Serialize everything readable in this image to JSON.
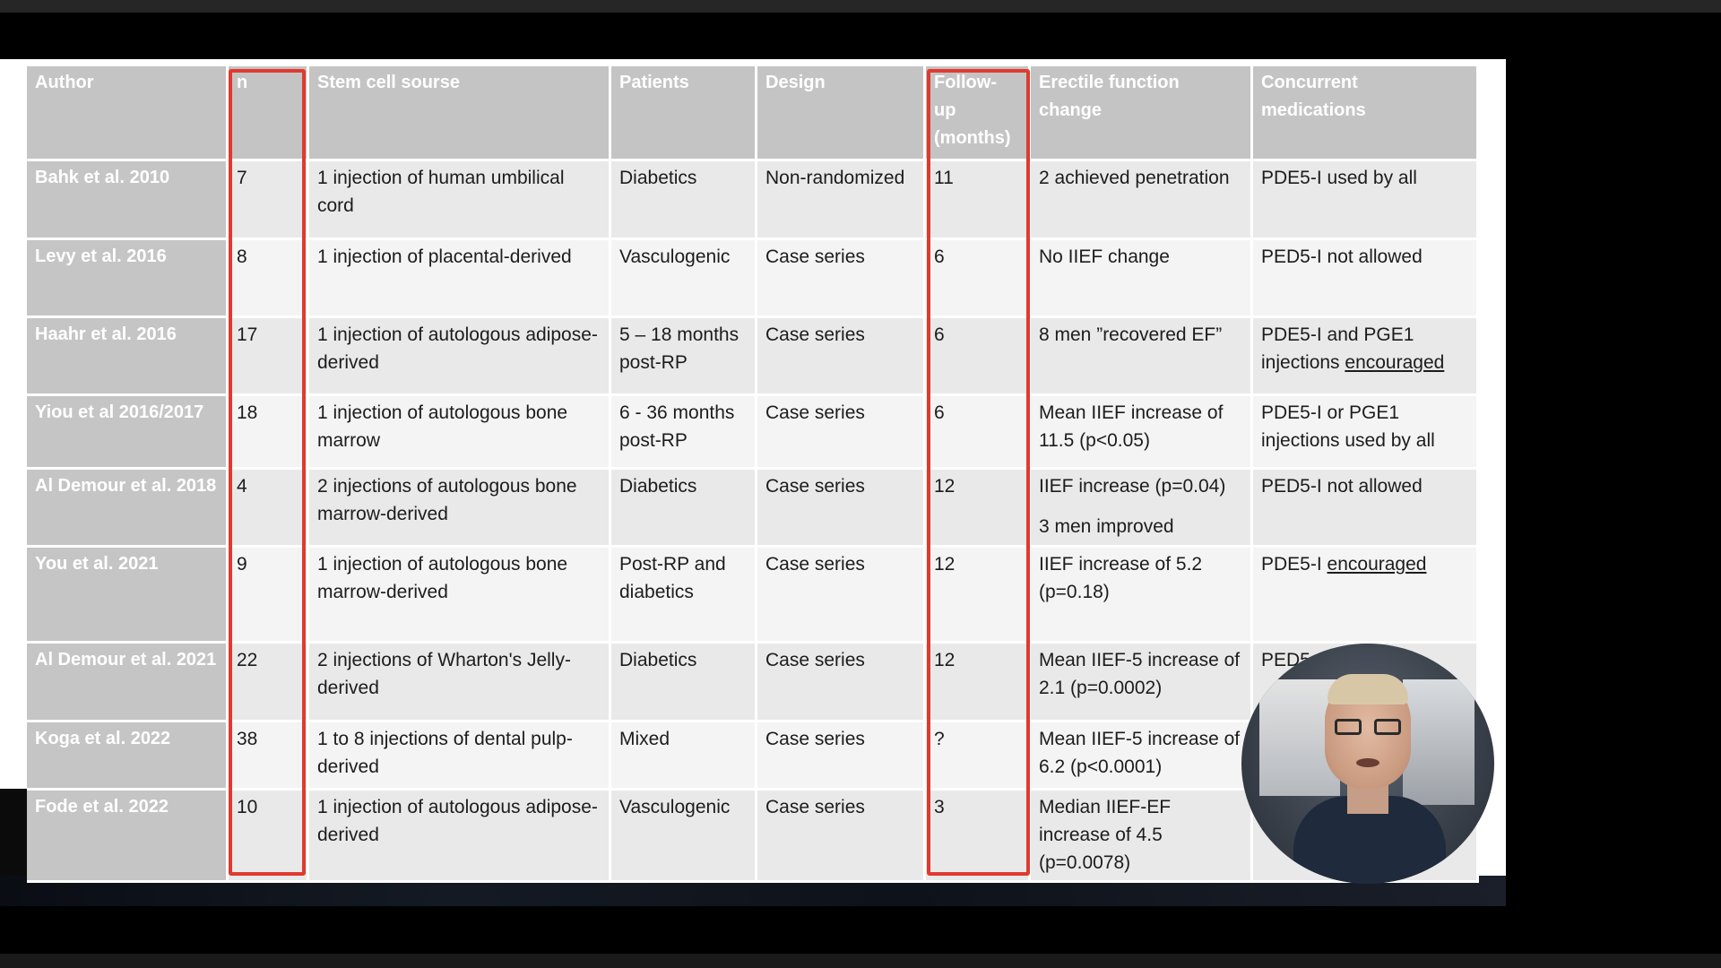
{
  "table": {
    "headers": [
      "Author",
      "n",
      "Stem cell sourse",
      "Patients",
      "Design",
      "Follow-up (months)",
      "Erectile function change",
      "Concurrent medications"
    ],
    "header_follow_up_lines": [
      "Follow-",
      "up",
      "(months)"
    ],
    "header_erectile_lines": [
      "Erectile function",
      "change"
    ],
    "header_concurrent_lines": [
      "Concurrent",
      "medications"
    ],
    "rows": [
      {
        "author": "Bahk et al.  2010",
        "n": "7",
        "source": "1 injection of human umbilical cord",
        "patients": "Diabetics",
        "design": "Non-randomized",
        "followup": "11",
        "ef_change": "2 achieved penetration",
        "meds": "PDE5-I used by all"
      },
      {
        "author": "Levy et al.  2016",
        "n": "8",
        "source": "1 injection of placental-derived",
        "patients": "Vasculogenic",
        "design": "Case series",
        "followup": "6",
        "ef_change": "No IIEF change",
        "meds": "PED5-I not allowed"
      },
      {
        "author": "Haahr et al. 2016",
        "n": "17",
        "source": "1 injection of autologous adipose-derived",
        "patients": "5 – 18 months post-RP",
        "design": "Case series",
        "followup": "6",
        "ef_change": "8 men ”recovered EF”",
        "meds_pre": "PDE5-I and PGE1 injections ",
        "meds_u": "encouraged"
      },
      {
        "author": "Yiou et al 2016/2017",
        "n": "18",
        "source": "1 injection of autologous bone marrow",
        "patients": "6 - 36 months post-RP",
        "design": "Case series",
        "followup": "6",
        "ef_change": "Mean IIEF increase of 11.5 (p<0.05)",
        "meds": "PDE5-I or PGE1 injections used by all"
      },
      {
        "author": "Al Demour et al. 2018",
        "n": "4",
        "source": "2 injections of autologous bone marrow-derived",
        "patients": "Diabetics",
        "design": "Case series",
        "followup": "12",
        "ef_change": "IIEF increase (p=0.04)",
        "ef_change2": "3 men improved",
        "meds": "PED5-I not allowed"
      },
      {
        "author": "You et al. 2021",
        "n": "9",
        "source": "1 injection of autologous bone marrow-derived",
        "patients": "Post-RP and diabetics",
        "design": "Case series",
        "followup": "12",
        "ef_change": "IIEF increase of 5.2 (p=0.18)",
        "meds_pre": "PDE5-I ",
        "meds_u": "encouraged"
      },
      {
        "author": "Al Demour et al. 2021",
        "n": "22",
        "source": "2 injections of Wharton's Jelly-derived",
        "patients": "Diabetics",
        "design": "Case series",
        "followup": "12",
        "ef_change": "Mean IIEF-5 increase of 2.1 (p=0.0002)",
        "meds": "PED5"
      },
      {
        "author": "Koga et al. 2022",
        "n": "38",
        "source": "1 to 8 injections of dental pulp-derived",
        "patients": "Mixed",
        "design": "Case series",
        "followup": "?",
        "ef_change": "Mean IIEF-5 increase of 6.2 (p<0.0001)",
        "meds": ""
      },
      {
        "author": "Fode et al. 2022",
        "n": "10",
        "source": "1 injection of autologous adipose-derived",
        "patients": "Vasculogenic",
        "design": "Case series",
        "followup": "3",
        "ef_change": "Median IIEF-EF increase of 4.5 (p=0.0078)",
        "meds": ""
      }
    ]
  },
  "colors": {
    "header_bg": "#c4c4c4",
    "highlight_red": "#e03a2f",
    "row_light": "#f4f4f4",
    "row_dark": "#e9e9e9"
  },
  "webcam": {
    "icon": "presenter-webcam-feed"
  }
}
